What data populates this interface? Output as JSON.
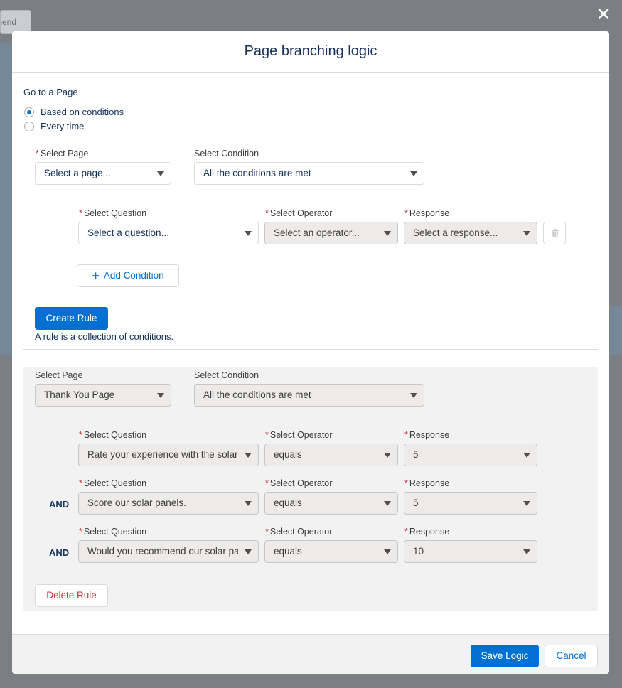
{
  "background": {
    "tab_label": "mend"
  },
  "modal": {
    "title": "Page branching logic",
    "go_to_label": "Go to a Page",
    "radio_options": [
      "Based on conditions",
      "Every time"
    ],
    "selected_radio": "Based on conditions"
  },
  "new_rule": {
    "page_label": "Select Page",
    "page_placeholder": "Select a page...",
    "condition_label": "Select Condition",
    "condition_value": "All the conditions are met",
    "question_label": "Select Question",
    "question_placeholder": "Select a question...",
    "operator_label": "Select Operator",
    "operator_placeholder": "Select an operator...",
    "response_label": "Response",
    "response_placeholder": "Select a response...",
    "add_condition_label": "Add Condition",
    "create_rule_label": "Create Rule",
    "help_text": "A rule is a collection of conditions."
  },
  "existing_rule": {
    "page_label": "Select Page",
    "page_value": "Thank You Page",
    "condition_label": "Select Condition",
    "condition_value": "All the conditions are met",
    "conditions": [
      {
        "connector": "",
        "question_label": "Select Question",
        "question": "Rate your experience with the solar panels",
        "operator_label": "Select Operator",
        "operator": "equals",
        "response_label": "Response",
        "response": "5"
      },
      {
        "connector": "AND",
        "question_label": "Select Question",
        "question": "Score our solar panels.",
        "operator_label": "Select Operator",
        "operator": "equals",
        "response_label": "Response",
        "response": "5"
      },
      {
        "connector": "AND",
        "question_label": "Select Question",
        "question": "Would you recommend our solar panels",
        "operator_label": "Select Operator",
        "operator": "equals",
        "response_label": "Response",
        "response": "10"
      }
    ],
    "delete_rule_label": "Delete Rule"
  },
  "footer": {
    "save_label": "Save Logic",
    "cancel_label": "Cancel"
  },
  "colors": {
    "brand": "#0070d2",
    "destructive": "#c23934",
    "text": "#16325c"
  }
}
